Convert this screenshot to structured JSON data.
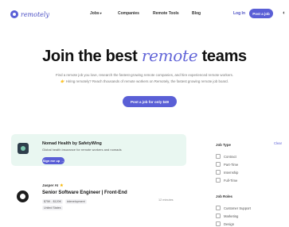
{
  "nav": {
    "logo_text": "remotely",
    "links": [
      {
        "label": "Jobs",
        "has_dropdown": true
      },
      {
        "label": "Companies"
      },
      {
        "label": "Remote Tools"
      },
      {
        "label": "Blog"
      }
    ],
    "login_label": "Log In",
    "post_job_label": "Post a job"
  },
  "hero": {
    "title_before": "Join the best",
    "title_highlight": "remote",
    "title_after": "teams",
    "subtitle_line1": "Find a remote job you love, research the fastest-growing remote companies, and hire experienced remote workers.",
    "subtitle_line2": "👉 Hiring remotely? Reach thousands of remote workers on Remotely, the fastest growing remote job board.",
    "cta_label": "Post a job for only $49"
  },
  "promo": {
    "title": "Nomad Health by SafetyWing",
    "description": "Global health insurance for remote workers and nomads",
    "button_label": "Sign me up →"
  },
  "job": {
    "company": "Jasper AI",
    "title": "Senior Software Engineer | Front-End",
    "tags": [
      "$75K - $120K",
      "#development"
    ],
    "location": "United States",
    "posted": "12 minutes"
  },
  "filters": {
    "job_type_heading": "Job Type",
    "clear_label": "Clear",
    "job_types": [
      "Contract",
      "Part-Time",
      "Internship",
      "Full-Time"
    ],
    "job_roles_heading": "Job Roles",
    "job_roles": [
      "Customer Support",
      "Marketing",
      "Design"
    ]
  },
  "colors": {
    "accent": "#5a5fd6",
    "promo_bg": "#e9f7f1"
  }
}
